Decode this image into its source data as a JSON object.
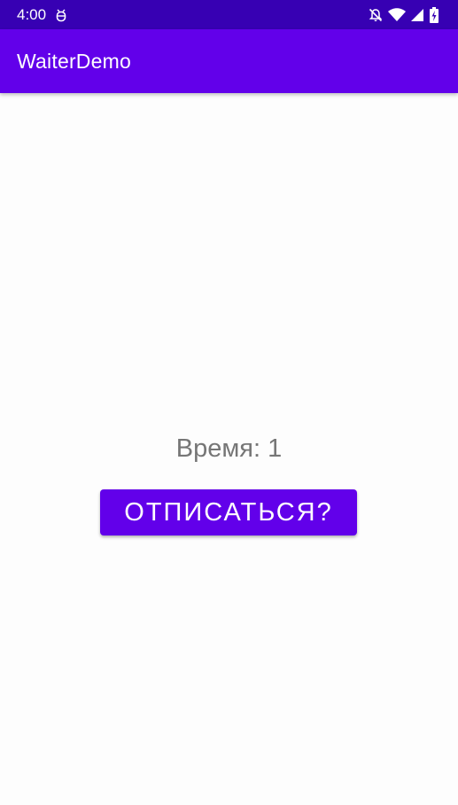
{
  "status_bar": {
    "time": "4:00",
    "icons": [
      "debug-icon",
      "notifications-off-icon",
      "wifi-icon",
      "cell-signal-icon",
      "battery-charging-icon"
    ]
  },
  "app_bar": {
    "title": "WaiterDemo"
  },
  "main": {
    "time_label": "Время: 1",
    "unsubscribe_button": "ОТПИСАТЬСЯ?"
  },
  "colors": {
    "status_bar": "#3700b3",
    "primary": "#6200ea",
    "text_secondary": "#767676",
    "background": "#fdfdfd"
  }
}
